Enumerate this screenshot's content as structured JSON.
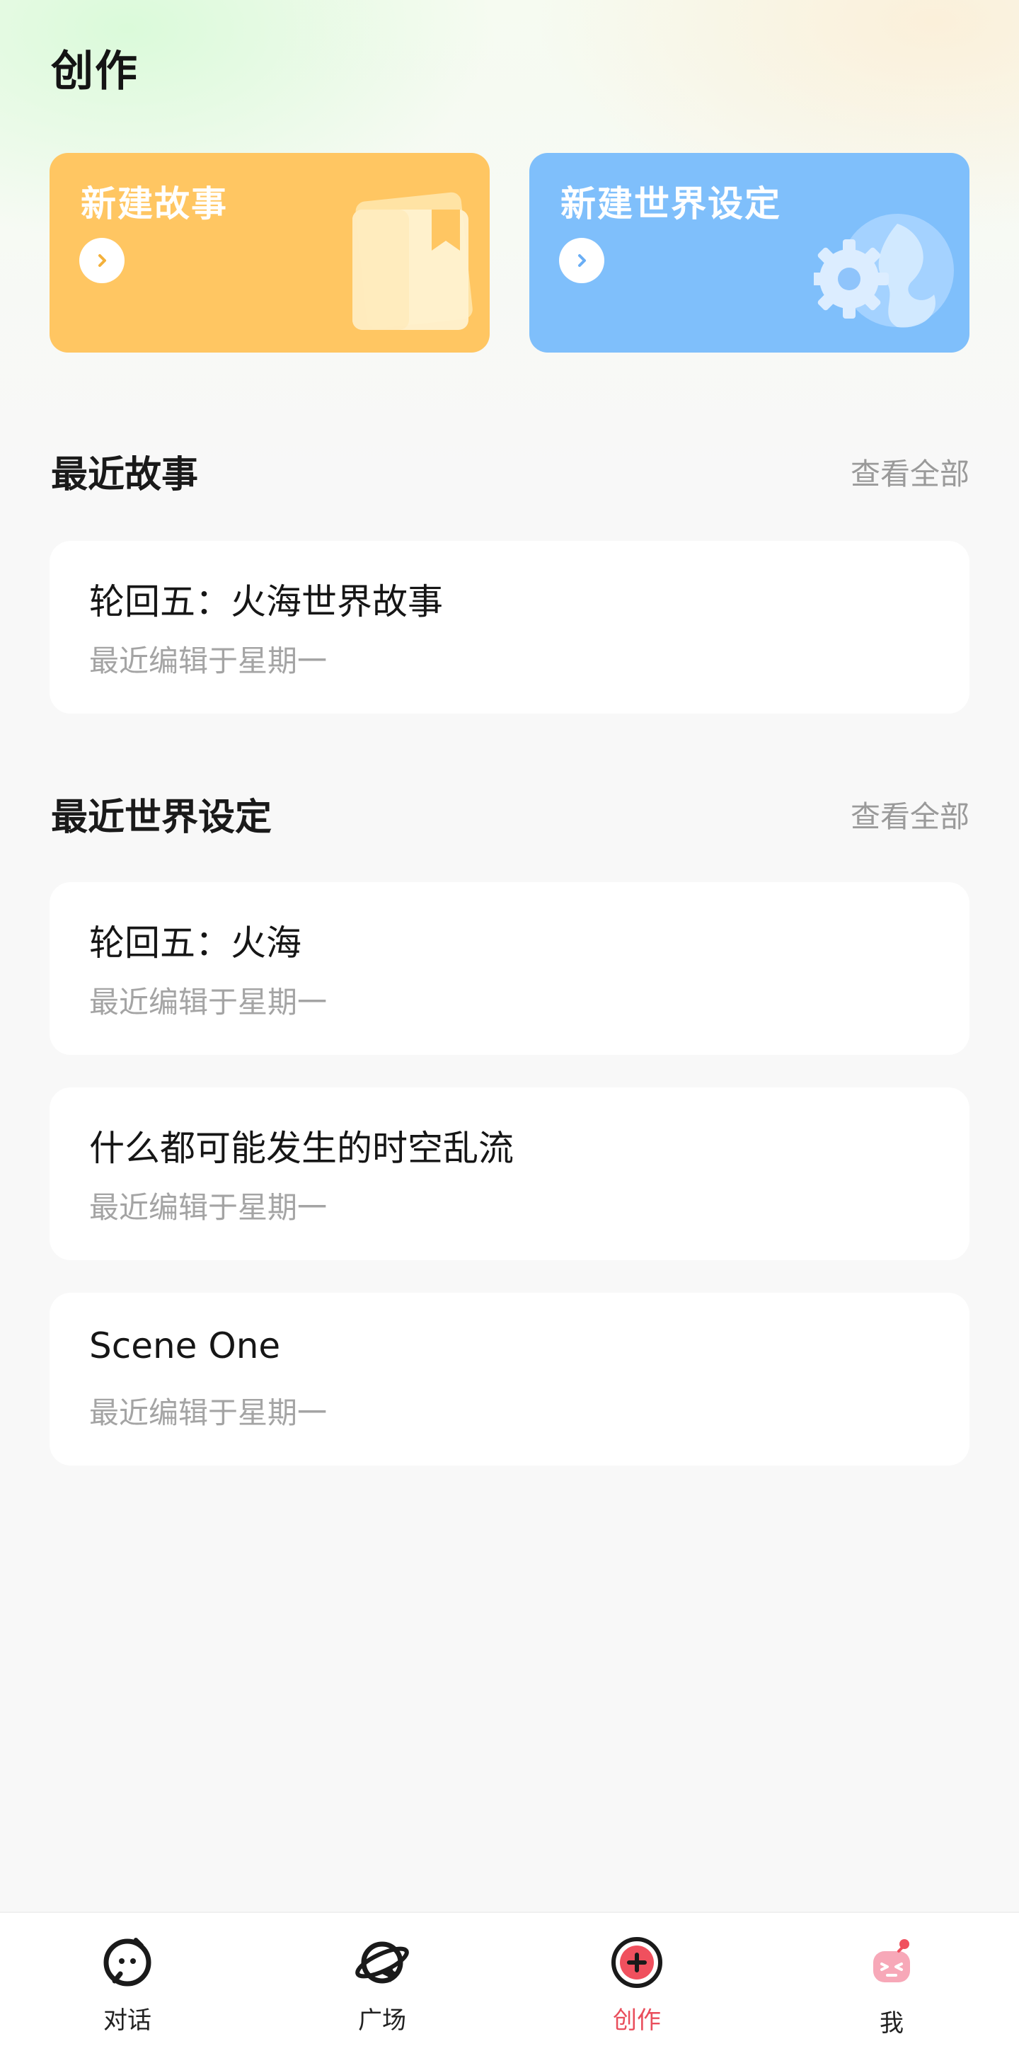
{
  "page": {
    "title": "创作"
  },
  "cards": {
    "new_story": {
      "label": "新建故事",
      "color": "#ffc662"
    },
    "new_world": {
      "label": "新建世界设定",
      "color": "#7fbffb"
    }
  },
  "recent_stories": {
    "heading": "最近故事",
    "see_all": "查看全部",
    "items": [
      {
        "title": "轮回五：火海世界故事",
        "subtitle": "最近编辑于星期一"
      }
    ]
  },
  "recent_worlds": {
    "heading": "最近世界设定",
    "see_all": "查看全部",
    "items": [
      {
        "title": "轮回五：火海",
        "subtitle": "最近编辑于星期一"
      },
      {
        "title": "什么都可能发生的时空乱流",
        "subtitle": "最近编辑于星期一"
      },
      {
        "title": "Scene One",
        "subtitle": "最近编辑于星期一"
      }
    ]
  },
  "tabbar": {
    "tabs": [
      {
        "label": "对话",
        "icon": "chat-face-icon",
        "active": false
      },
      {
        "label": "广场",
        "icon": "plaza-icon",
        "active": false
      },
      {
        "label": "创作",
        "icon": "create-plus-icon",
        "active": true
      },
      {
        "label": "我",
        "icon": "profile-robot-icon",
        "active": false
      }
    ],
    "active_color": "#e94e5c"
  }
}
